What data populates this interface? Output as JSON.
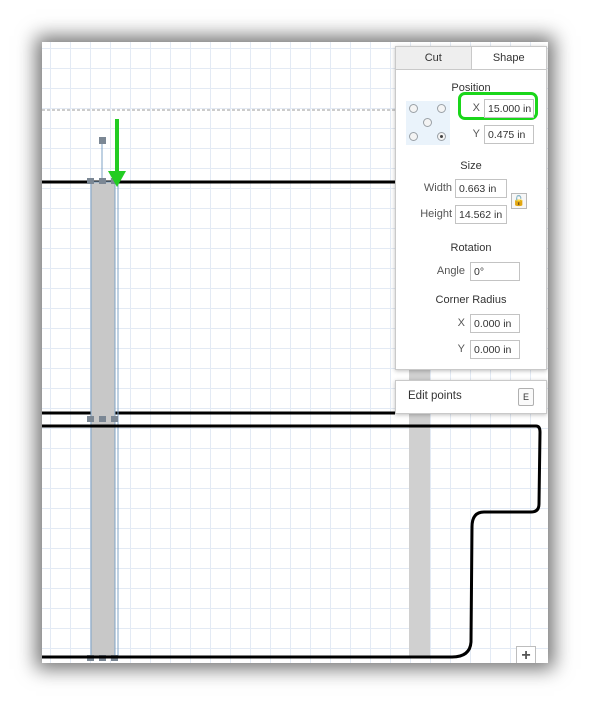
{
  "tabs": [
    {
      "label": "Cut",
      "active": false
    },
    {
      "label": "Shape",
      "active": true
    }
  ],
  "position": {
    "title": "Position",
    "x_label": "X",
    "x_value": "15.000 in",
    "y_label": "Y",
    "y_value": "0.475 in",
    "selected_anchor": "bottom-right"
  },
  "size": {
    "title": "Size",
    "width_label": "Width",
    "width_value": "0.663 in",
    "height_label": "Height",
    "height_value": "14.562 in",
    "lock_icon": "unlock-icon"
  },
  "rotation": {
    "title": "Rotation",
    "angle_label": "Angle",
    "angle_value": "0°"
  },
  "corner_radius": {
    "title": "Corner Radius",
    "x_label": "X",
    "x_value": "0.000 in",
    "y_label": "Y",
    "y_value": "0.000 in"
  },
  "edit_points": {
    "label": "Edit points",
    "shortcut": "E"
  },
  "zoom_button": {
    "label": "+"
  },
  "colors": {
    "highlight": "#1ad61a",
    "arrow": "#22cc22",
    "selected_bar": "#c8c8c8",
    "grid": "#e3eaf4"
  }
}
